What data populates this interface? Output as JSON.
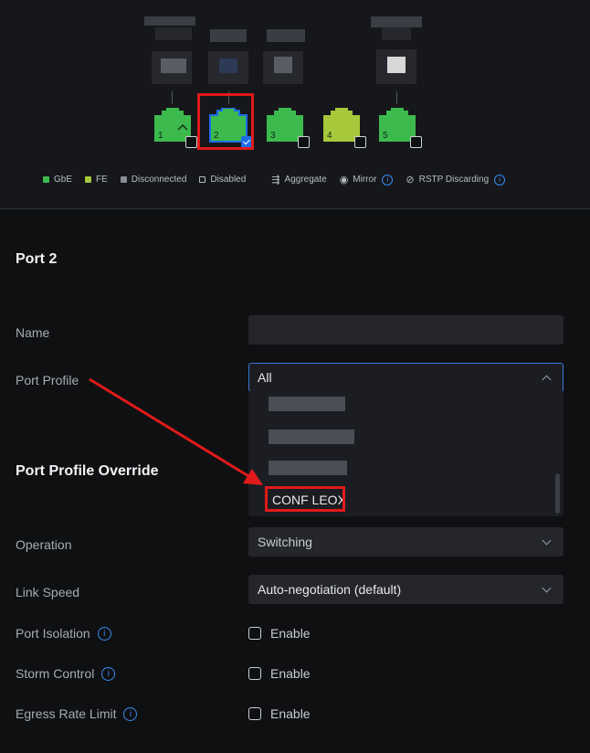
{
  "ports": [
    {
      "number": "1",
      "speed": "GbE",
      "color": "#3dba4e",
      "selected": false,
      "uplink": true
    },
    {
      "number": "2",
      "speed": "GbE",
      "color": "#3dba4e",
      "selected": true,
      "uplink": false
    },
    {
      "number": "3",
      "speed": "GbE",
      "color": "#3dba4e",
      "selected": false,
      "uplink": false
    },
    {
      "number": "4",
      "speed": "FE",
      "color": "#a7c83a",
      "selected": false,
      "uplink": false
    },
    {
      "number": "5",
      "speed": "GbE",
      "color": "#3dba4e",
      "selected": false,
      "uplink": false
    }
  ],
  "legend": {
    "gbe": "GbE",
    "gbe_color": "#3dba4e",
    "fe": "FE",
    "fe_color": "#a7c83a",
    "disconnected": "Disconnected",
    "disconnected_color": "#8a8d93",
    "disabled": "Disabled",
    "aggregate": "Aggregate",
    "mirror": "Mirror",
    "rstp": "RSTP Discarding"
  },
  "port_section": {
    "title": "Port 2",
    "name_label": "Name",
    "name_value": "",
    "profile_label": "Port Profile",
    "profile_value": "All",
    "profile_options_visible": [
      "CONF LEOX"
    ]
  },
  "override": {
    "title": "Port Profile Override",
    "operation_label": "Operation",
    "operation_value": "Switching",
    "link_speed_label": "Link Speed",
    "link_speed_value": "Auto-negotiation (default)",
    "isolation_label": "Port Isolation",
    "storm_label": "Storm Control",
    "egress_label": "Egress Rate Limit",
    "enable_label": "Enable"
  },
  "colors": {
    "accent": "#1c6ee8",
    "annotation": "#e01a1a"
  }
}
